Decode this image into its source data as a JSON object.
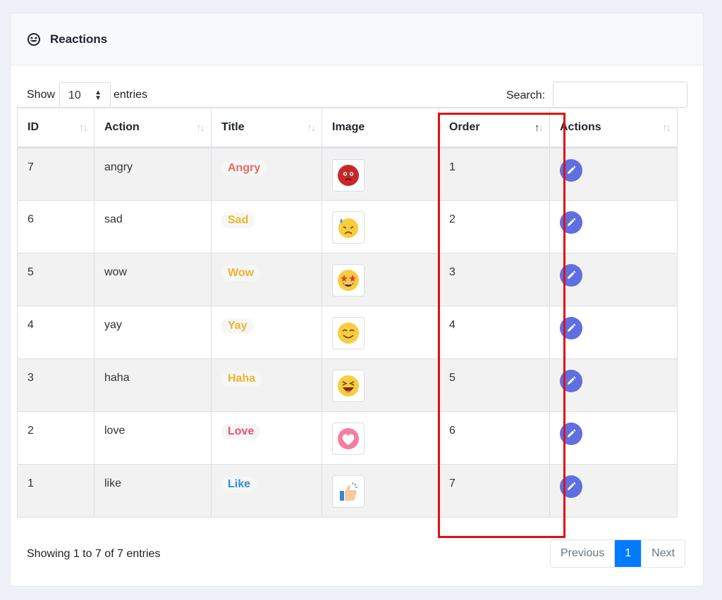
{
  "card": {
    "title": "Reactions",
    "icon": "smiley-outline-icon"
  },
  "controls": {
    "show_label": "Show",
    "length_value": "10",
    "entries_label": "entries",
    "search_label": "Search:",
    "search_value": ""
  },
  "columns": [
    "ID",
    "Action",
    "Title",
    "Image",
    "Order",
    "Actions"
  ],
  "sorted_column": "Order",
  "rows": [
    {
      "id": "7",
      "action": "angry",
      "title": "Angry",
      "title_color": "#ea6b5c",
      "emoji": "angry",
      "order": "1"
    },
    {
      "id": "6",
      "action": "sad",
      "title": "Sad",
      "title_color": "#f0b429",
      "emoji": "sad",
      "order": "2"
    },
    {
      "id": "5",
      "action": "wow",
      "title": "Wow",
      "title_color": "#f0b429",
      "emoji": "wow",
      "order": "3"
    },
    {
      "id": "4",
      "action": "yay",
      "title": "Yay",
      "title_color": "#f0b429",
      "emoji": "yay",
      "order": "4"
    },
    {
      "id": "3",
      "action": "haha",
      "title": "Haha",
      "title_color": "#f0b429",
      "emoji": "haha",
      "order": "5"
    },
    {
      "id": "2",
      "action": "love",
      "title": "Love",
      "title_color": "#f0506e",
      "emoji": "love",
      "order": "6"
    },
    {
      "id": "1",
      "action": "like",
      "title": "Like",
      "title_color": "#2d8fd6",
      "emoji": "like",
      "order": "7"
    }
  ],
  "footer": {
    "info": "Showing 1 to 7 of 7 entries",
    "previous": "Previous",
    "current_page": "1",
    "next": "Next"
  },
  "colors": {
    "accent": "#007bff",
    "edit_button": "#5f6ee0",
    "highlight": "#e01010"
  }
}
